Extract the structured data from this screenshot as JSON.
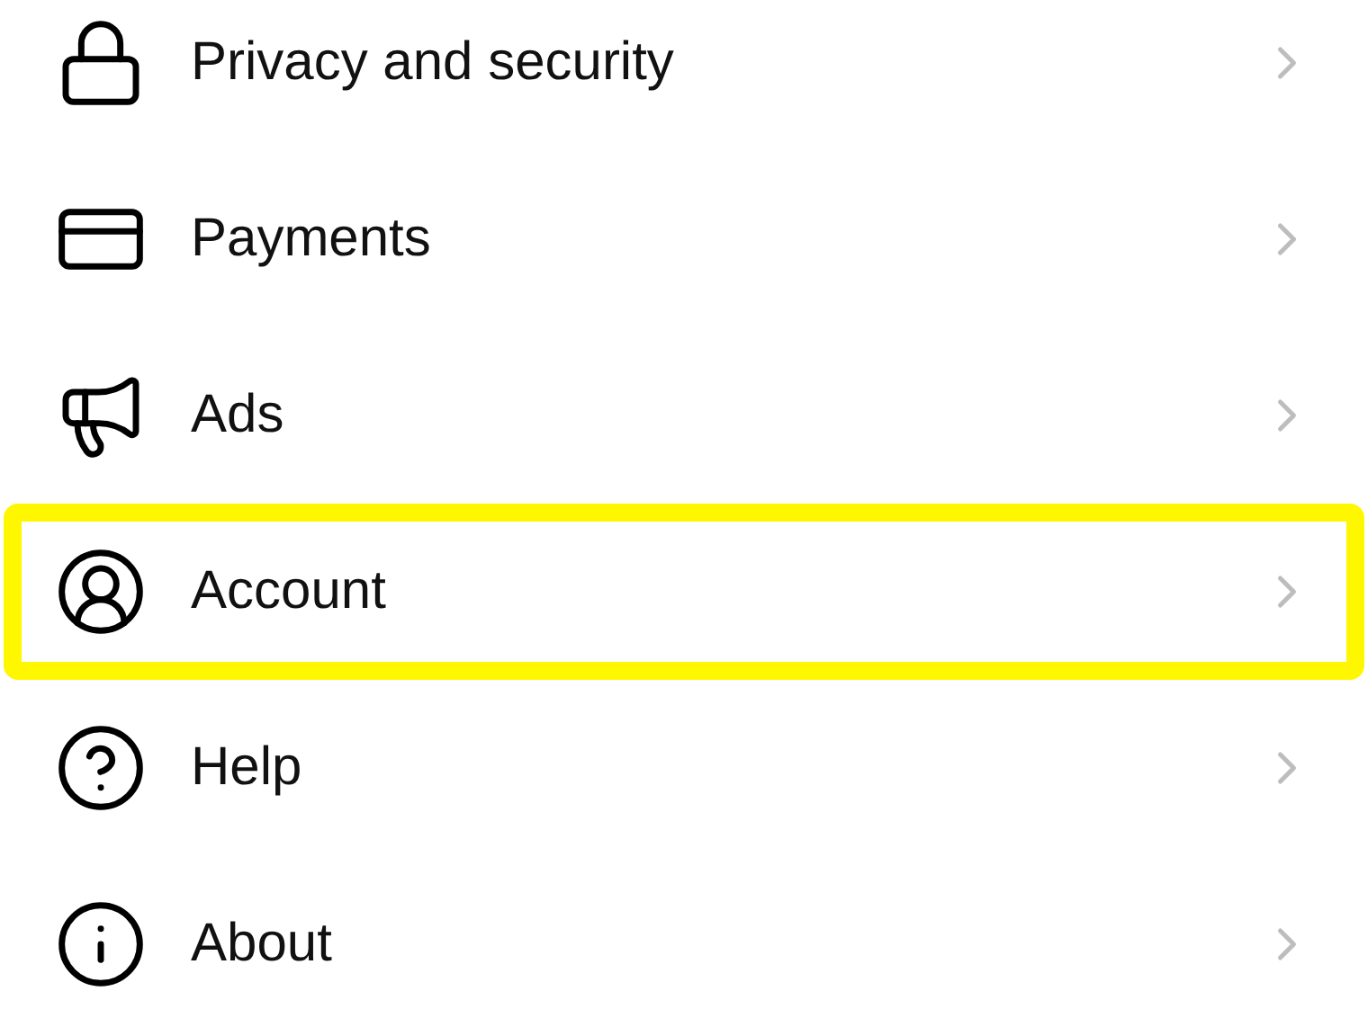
{
  "settings_items": [
    {
      "label": "Privacy and security",
      "highlighted": false
    },
    {
      "label": "Payments",
      "highlighted": false
    },
    {
      "label": "Ads",
      "highlighted": false
    },
    {
      "label": "Account",
      "highlighted": true
    },
    {
      "label": "Help",
      "highlighted": false
    },
    {
      "label": "About",
      "highlighted": false
    }
  ]
}
